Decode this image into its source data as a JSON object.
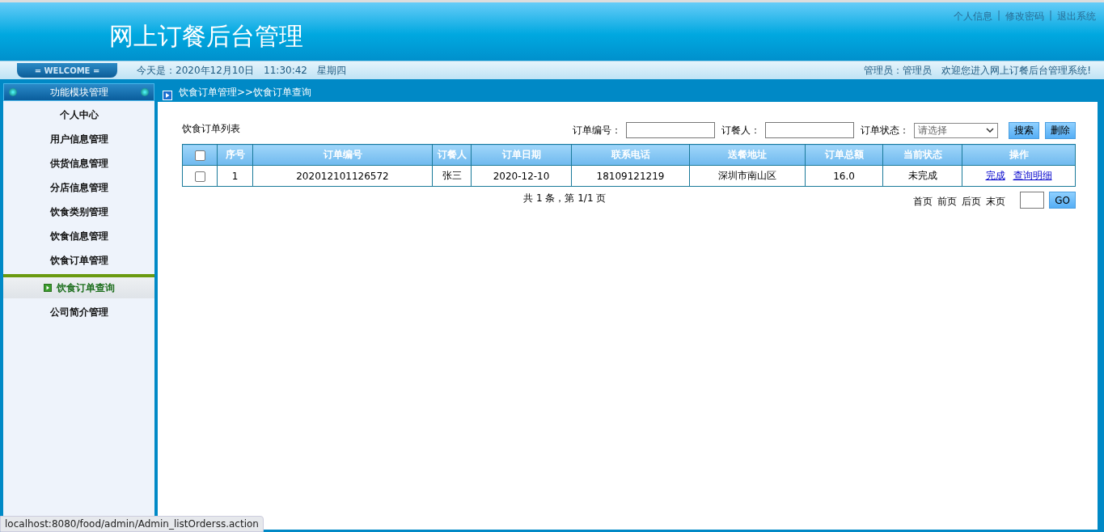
{
  "header": {
    "title": "网上订餐后台管理",
    "links": [
      "个人信息",
      "修改密码",
      "退出系统"
    ],
    "separator": "|"
  },
  "welcome_bar": {
    "badge": "= WELCOME =",
    "date": "今天是：2020年12月10日",
    "time": "11:30:42",
    "weekday": "星期四",
    "admin": "管理员：管理员",
    "greeting": "欢迎您进入网上订餐后台管理系统!"
  },
  "sidebar": {
    "title": "功能模块管理",
    "items": [
      {
        "label": "个人中心",
        "selected": false
      },
      {
        "label": "用户信息管理",
        "selected": false
      },
      {
        "label": "供货信息管理",
        "selected": false
      },
      {
        "label": "分店信息管理",
        "selected": false
      },
      {
        "label": "饮食类别管理",
        "selected": false
      },
      {
        "label": "饮食信息管理",
        "selected": false
      },
      {
        "label": "饮食订单管理",
        "selected": false
      },
      {
        "label": "饮食订单查询",
        "selected": true
      },
      {
        "label": "公司简介管理",
        "selected": false
      }
    ]
  },
  "breadcrumb": "饮食订单管理>>饮食订单查询",
  "list_title": "饮食订单列表",
  "filters": {
    "order_no_label": "订单编号：",
    "customer_label": "订餐人：",
    "status_label": "订单状态：",
    "status_placeholder": "请选择",
    "search_button": "搜索",
    "delete_button": "删除"
  },
  "table": {
    "columns": [
      "序号",
      "订单编号",
      "订餐人",
      "订单日期",
      "联系电话",
      "送餐地址",
      "订单总额",
      "当前状态",
      "操作"
    ],
    "select_all_checked": false,
    "rows": [
      {
        "checked": false,
        "cells": [
          "1",
          "202012101126572",
          "张三",
          "2020-12-10",
          "18109121219",
          "深圳市南山区",
          "16.0",
          "未完成"
        ],
        "actions": [
          "完成",
          "查询明细"
        ]
      }
    ]
  },
  "pagination": {
    "summary": "共 1 条，第 1/1 页",
    "links": [
      "首页",
      "前页",
      "后页",
      "末页"
    ],
    "go_button": "GO"
  },
  "status_url": "localhost:8080/food/admin/Admin_listOrderss.action"
}
